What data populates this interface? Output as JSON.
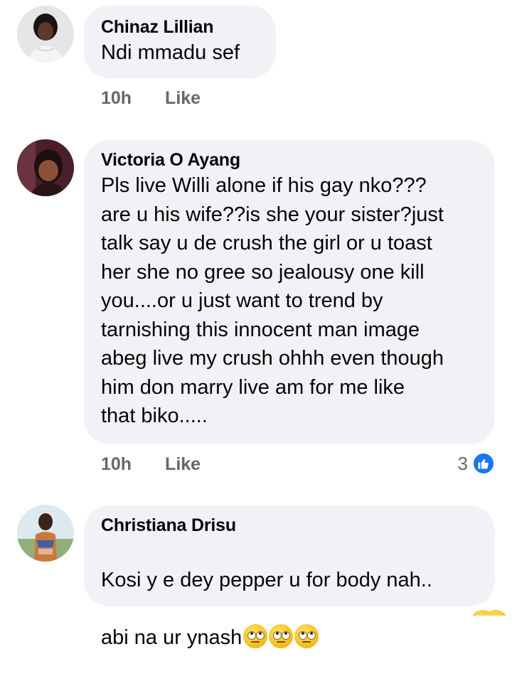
{
  "comments": [
    {
      "author": "Chinaz Lillian",
      "text": "Ndi mmadu sef",
      "time": "10h",
      "like_label": "Like"
    },
    {
      "author": "Victoria O Ayang",
      "text": "Pls live Willi alone if his gay nko???\nare u his wife??is she your sister?just\ntalk say u de crush the girl or u toast\nher she no gree so jealousy one kill\nyou....or u just want to trend by\ntarnishing this innocent man image\nabeg live my crush ohhh even though\nhim don marry live am for me like\nthat biko.....",
      "time": "10h",
      "like_label": "Like",
      "reaction_count": "3",
      "reaction_icon": "like-icon"
    },
    {
      "author": "Christiana Drisu",
      "text_line1": "Kosi y e dey pepper u for body nah..",
      "text_line2": "abi na ur ynash",
      "emoji_icon": "face-with-rolling-eyes-icon",
      "emoji_count": 3
    }
  ],
  "colors": {
    "bubble": "#f0f2f5",
    "meta": "#65676b",
    "like_blue": "#1877f2"
  }
}
